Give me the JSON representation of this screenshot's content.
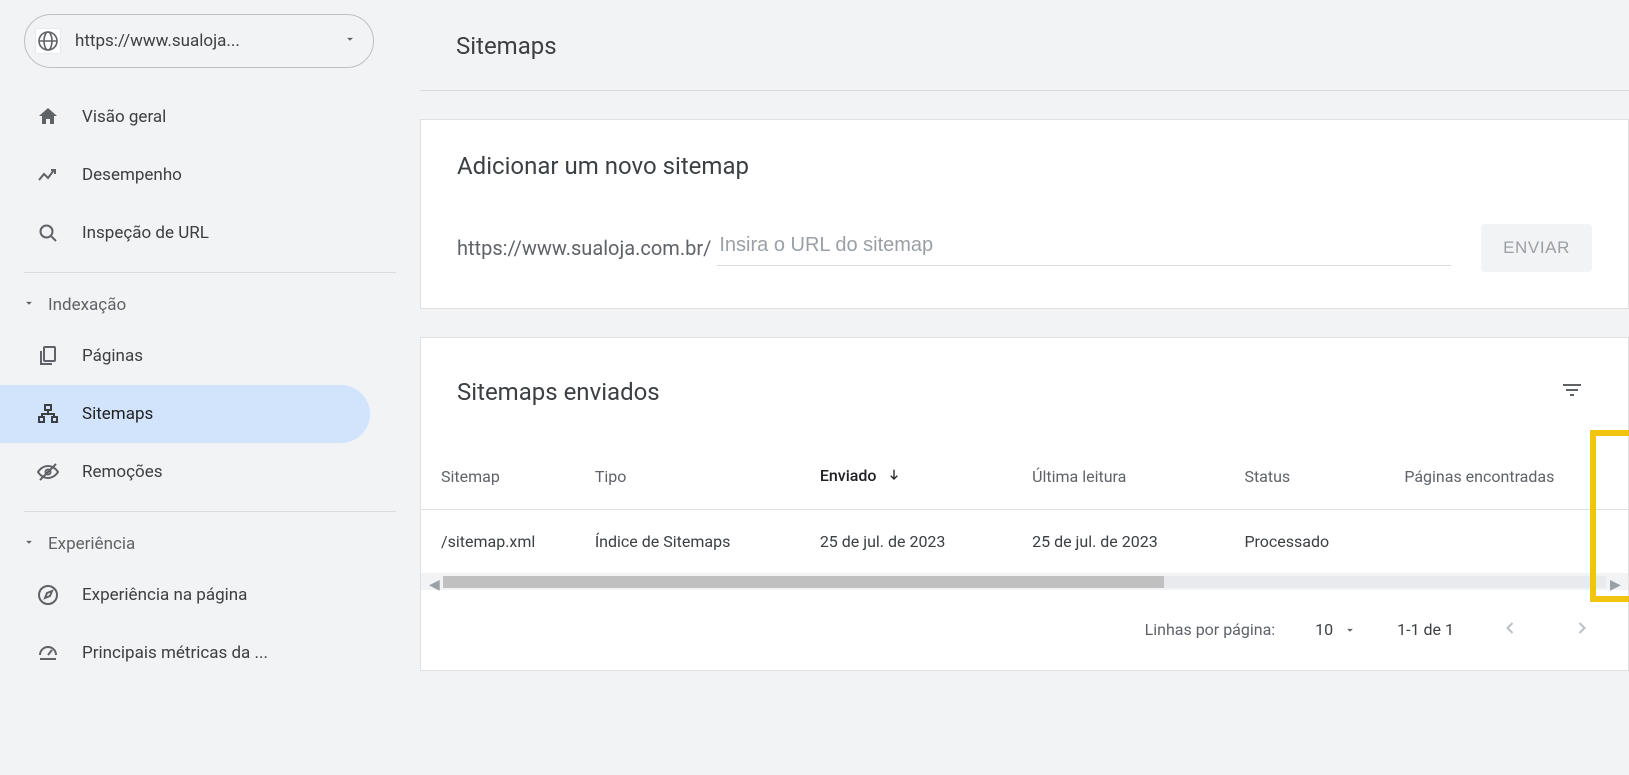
{
  "property": {
    "url": "https://www.sualoja..."
  },
  "sidebar": {
    "items": [
      {
        "label": "Visão geral"
      },
      {
        "label": "Desempenho"
      },
      {
        "label": "Inspeção de URL"
      }
    ],
    "indexing_header": "Indexação",
    "index_items": [
      {
        "label": "Páginas"
      },
      {
        "label": "Sitemaps"
      },
      {
        "label": "Remoções"
      }
    ],
    "experience_header": "Experiência",
    "experience_items": [
      {
        "label": "Experiência na página"
      },
      {
        "label": "Principais métricas da ..."
      }
    ]
  },
  "page": {
    "title": "Sitemaps"
  },
  "add_card": {
    "title": "Adicionar um novo sitemap",
    "url_prefix": "https://www.sualoja.com.br/",
    "placeholder": "Insira o URL do sitemap",
    "submit": "ENVIAR"
  },
  "list_card": {
    "title": "Sitemaps enviados",
    "columns": {
      "sitemap": "Sitemap",
      "type": "Tipo",
      "sent": "Enviado",
      "last_read": "Última leitura",
      "status": "Status",
      "pages_found": "Páginas encontradas"
    },
    "rows": [
      {
        "sitemap": "/sitemap.xml",
        "type": "Índice de Sitemaps",
        "sent": "25 de jul. de 2023",
        "last_read": "25 de jul. de 2023",
        "status": "Processado"
      }
    ],
    "pagination": {
      "rows_label": "Linhas por página:",
      "rows_value": "10",
      "range": "1-1 de 1"
    }
  }
}
